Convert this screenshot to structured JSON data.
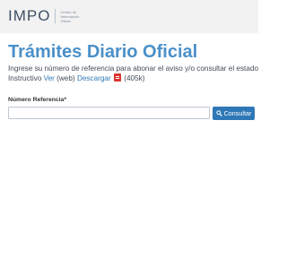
{
  "header": {
    "logo_text": "IMPO",
    "logo_sub": [
      "Centro de",
      "Información",
      "Oficial"
    ]
  },
  "main": {
    "title": "Trámites Diario Oficial",
    "intro_line1": "Ingrese su número de referencia para abonar el aviso y/o consultar el estado del trámite.",
    "instructivo_label": "Instructivo",
    "ver_link": "Ver",
    "web_suffix": "(web)",
    "descargar_link": "Descargar",
    "file_size": "(405k)",
    "field_label": "Número Referencia*",
    "field_value": "",
    "field_placeholder": "",
    "consultar_label": "Consultar"
  },
  "icons": {
    "pdf": "pdf-icon",
    "search": "search-icon"
  },
  "colors": {
    "title": "#4a90c8",
    "link": "#2f78b7",
    "button": "#2f78b7",
    "header_bg": "#f2f2f2",
    "pdf": "#d9372f"
  }
}
